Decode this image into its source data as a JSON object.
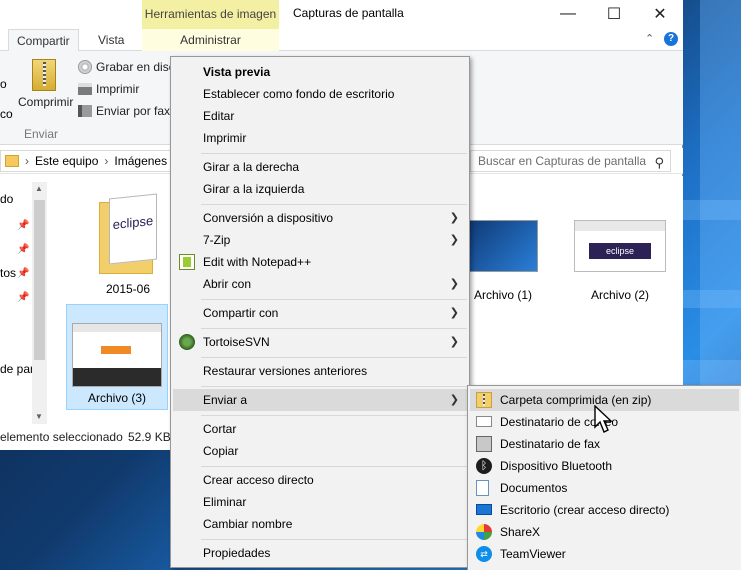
{
  "window": {
    "context_tab_title": "Herramientas de imagen",
    "title": "Capturas de pantalla",
    "minimize_glyph": "—",
    "maximize_glyph": "☐",
    "close_glyph": "✕"
  },
  "tabs": {
    "compartir": "Compartir",
    "vista": "Vista",
    "administrar": "Administrar"
  },
  "ribbon": {
    "comprimir": "Comprimir",
    "grabar": "Grabar en disco",
    "imprimir": "Imprimir",
    "enviar_fax": "Enviar por fax",
    "group_label": "Enviar",
    "left_trunc": "co"
  },
  "address": {
    "crumb1": "Este equipo",
    "crumb2": "Imágenes",
    "search_placeholder": "Buscar en Capturas de pantalla"
  },
  "navpane": {
    "item1": "do",
    "item2": "tos",
    "item3": "de pan"
  },
  "files": [
    {
      "name": "2015-06"
    },
    {
      "name": "Archivo (1)"
    },
    {
      "name": "Archivo (2)"
    },
    {
      "name": "Archivo (3)"
    }
  ],
  "thumb_text": {
    "eclipse": "eclipse"
  },
  "status": {
    "selected": "elemento seleccionado",
    "size": "52.9 KB"
  },
  "context_menu": {
    "vista_previa": "Vista previa",
    "fondo": "Establecer como fondo de escritorio",
    "editar": "Editar",
    "imprimir": "Imprimir",
    "girar_derecha": "Girar a la derecha",
    "girar_izquierda": "Girar a la izquierda",
    "conversion": "Conversión a dispositivo",
    "sevenzip": "7-Zip",
    "notepad": "Edit with Notepad++",
    "abrir_con": "Abrir con",
    "compartir_con": "Compartir con",
    "tortoise": "TortoiseSVN",
    "restaurar": "Restaurar versiones anteriores",
    "enviar_a": "Enviar a",
    "cortar": "Cortar",
    "copiar": "Copiar",
    "crear_acceso": "Crear acceso directo",
    "eliminar": "Eliminar",
    "cambiar_nombre": "Cambiar nombre",
    "propiedades": "Propiedades",
    "arrow_glyph": "❯"
  },
  "submenu": {
    "zip": "Carpeta comprimida (en zip)",
    "correo": "Destinatario de correo",
    "fax": "Destinatario de fax",
    "bluetooth": "Dispositivo Bluetooth",
    "documentos": "Documentos",
    "escritorio": "Escritorio (crear acceso directo)",
    "sharex": "ShareX",
    "teamviewer": "TeamViewer"
  },
  "colors": {
    "menu_bg": "#f2f2f2",
    "menu_highlight": "#dadada",
    "selection": "#cce8ff",
    "context_tab": "#f4f0a3"
  }
}
